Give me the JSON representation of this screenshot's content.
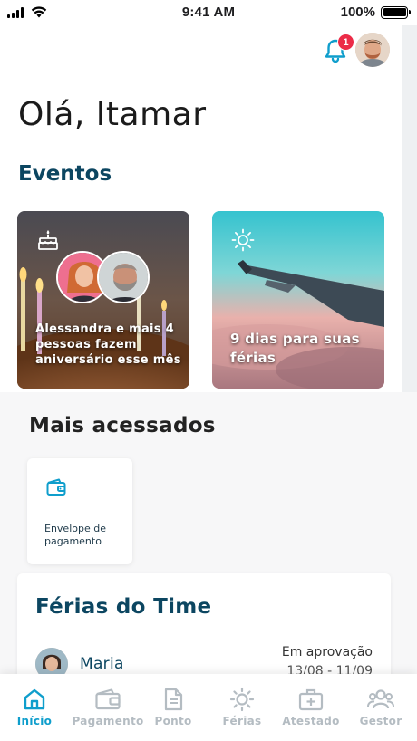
{
  "status_bar": {
    "time": "9:41 AM",
    "battery": "100%"
  },
  "header": {
    "notification_count": "1"
  },
  "greeting": "Olá, Itamar",
  "events": {
    "title": "Eventos",
    "birthday_text": "Alessandra e mais 4 pessoas fazem aniversário esse mês",
    "vacation_text": "9 dias para suas férias"
  },
  "most_accessed": {
    "title": "Mais acessados",
    "items": [
      {
        "label": "Envelope de pagamento",
        "icon": "wallet-icon"
      }
    ]
  },
  "team_vacations": {
    "title": "Férias do Time",
    "entries": [
      {
        "name": "Maria",
        "status": "Em aprovação",
        "dates": "13/08 - 11/09"
      }
    ]
  },
  "tab_bar": {
    "items": [
      {
        "label": "Início",
        "icon": "home-icon",
        "active": true
      },
      {
        "label": "Pagamento",
        "icon": "wallet-icon",
        "active": false
      },
      {
        "label": "Ponto",
        "icon": "document-icon",
        "active": false
      },
      {
        "label": "Férias",
        "icon": "sun-icon",
        "active": false
      },
      {
        "label": "Atestado",
        "icon": "medical-case-icon",
        "active": false
      },
      {
        "label": "Gestor",
        "icon": "team-icon",
        "active": false
      }
    ]
  },
  "colors": {
    "accent": "#0f9ecc",
    "heading": "#0c4661",
    "badge": "#ec2b47",
    "inactive": "#b4bcc2"
  }
}
